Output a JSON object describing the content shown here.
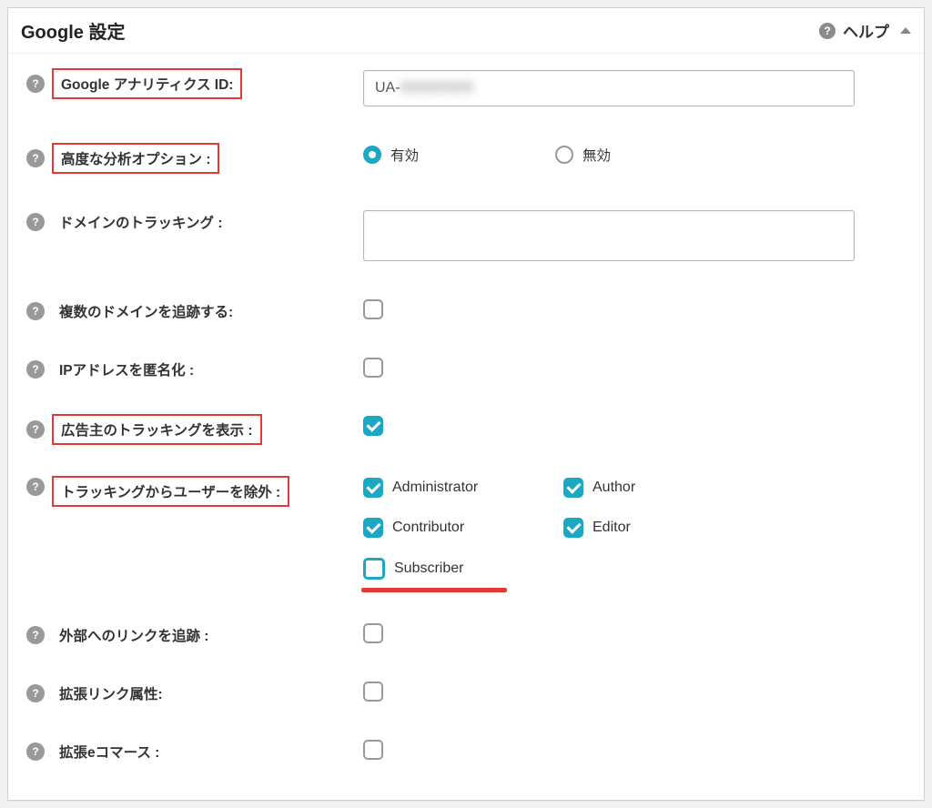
{
  "panel": {
    "title": "Google 設定",
    "help_label": "ヘルプ"
  },
  "fields": {
    "ga_id": {
      "label": "Google アナリティクス ID:",
      "value_prefix": "UA-",
      "value_blurred": "000000000"
    },
    "advanced_analysis": {
      "label": "高度な分析オプション :",
      "option_enabled": "有効",
      "option_disabled": "無効",
      "selected": "enabled"
    },
    "domain_tracking": {
      "label": "ドメインのトラッキング :",
      "value": ""
    },
    "track_multi_domain": {
      "label": "複数のドメインを追跡する:",
      "checked": false
    },
    "anonymize_ip": {
      "label": "IPアドレスを匿名化 :",
      "checked": false
    },
    "advertiser_tracking": {
      "label": "広告主のトラッキングを表示 :",
      "checked": true
    },
    "exclude_users": {
      "label": "トラッキングからユーザーを除外 :",
      "roles": [
        {
          "key": "administrator",
          "label": "Administrator",
          "checked": true
        },
        {
          "key": "author",
          "label": "Author",
          "checked": true
        },
        {
          "key": "contributor",
          "label": "Contributor",
          "checked": true
        },
        {
          "key": "editor",
          "label": "Editor",
          "checked": true
        },
        {
          "key": "subscriber",
          "label": "Subscriber",
          "checked": false
        }
      ]
    },
    "track_outbound": {
      "label": "外部へのリンクを追跡 :",
      "checked": false
    },
    "enhanced_link_attr": {
      "label": "拡張リンク属性:",
      "checked": false
    },
    "enhanced_ecommerce": {
      "label": "拡張eコマース :",
      "checked": false
    }
  }
}
